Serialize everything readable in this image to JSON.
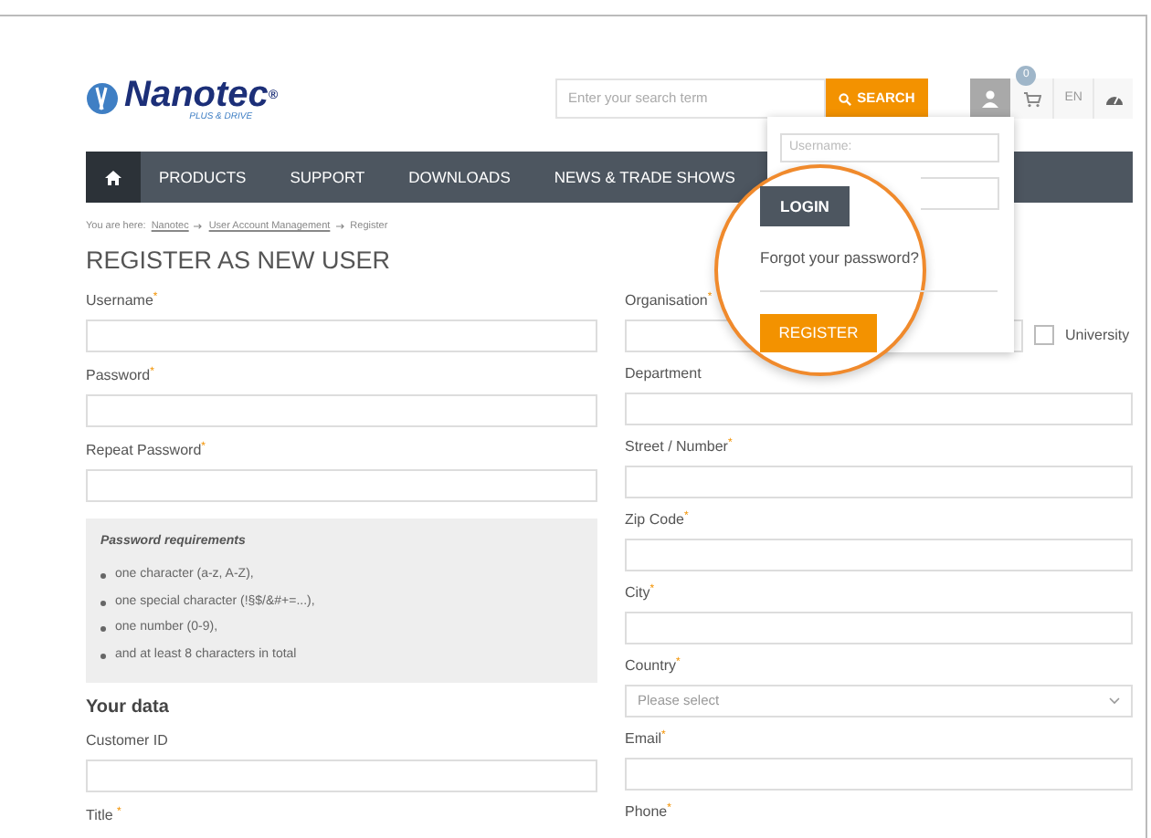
{
  "header": {
    "logo": {
      "name": "Nanotec",
      "mark": "®",
      "tagline": "PLUS & DRIVE"
    },
    "search": {
      "placeholder": "Enter your search term",
      "button": "SEARCH"
    },
    "cart_count": "0",
    "language": "EN"
  },
  "nav": {
    "home_selected": true,
    "items": [
      {
        "label": "PRODUCTS"
      },
      {
        "label": "SUPPORT"
      },
      {
        "label": "DOWNLOADS"
      },
      {
        "label": "NEWS & TRADE SHOWS"
      }
    ]
  },
  "breadcrumb": {
    "prefix": "You are here:",
    "items": [
      {
        "label": "Nanotec",
        "link": true
      },
      {
        "label": "User Account Management",
        "link": true
      },
      {
        "label": "Register",
        "link": false
      }
    ]
  },
  "title": "REGISTER AS NEW USER",
  "left": [
    {
      "kind": "field",
      "label": "Username$^{*}$"
    },
    {
      "kind": "field",
      "label": "Password$^{*}$"
    },
    {
      "kind": "field",
      "label": "Repeat Password$^{*}$"
    },
    {
      "kind": "note",
      "title": "Password requirements",
      "items": [
        "one character (a-z, A-Z),",
        "one special character (!§$/&#+=...),",
        "one number (0-9),",
        "and at least 8 characters in total"
      ]
    },
    {
      "kind": "heading",
      "label": "Your data"
    },
    {
      "kind": "field",
      "label": "Customer ID"
    },
    {
      "kind": "label",
      "label": "Title $^{*}$"
    }
  ],
  "right": [
    {
      "kind": "check_field",
      "label": "Organisation$^{*}$",
      "check_label": "University",
      "checked": false
    },
    {
      "kind": "field",
      "label": "Department"
    },
    {
      "kind": "field",
      "label": "Street / Number$^{*}$"
    },
    {
      "kind": "field",
      "label": "Zip Code$^{*}$"
    },
    {
      "kind": "field",
      "label": "City$^{*}$"
    },
    {
      "kind": "select",
      "label": "Country$^{*}$",
      "placeholder": "Please select"
    },
    {
      "kind": "field",
      "label": "Email$^{*}$"
    },
    {
      "kind": "label",
      "label": "Phone$^{*}$"
    }
  ],
  "login_popup": {
    "username_placeholder": "Username:",
    "login": "LOGIN",
    "forgot": "Forgot your password?",
    "register": "REGISTER"
  }
}
